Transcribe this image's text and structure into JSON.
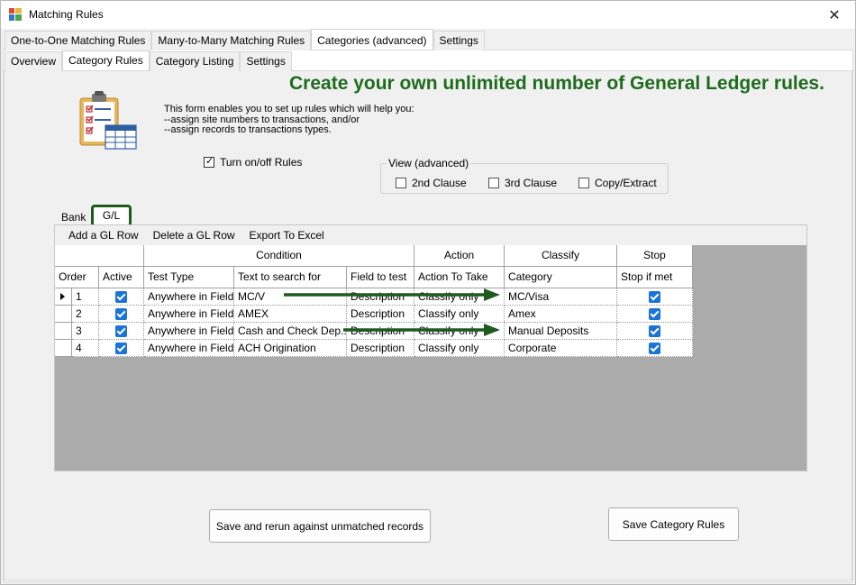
{
  "window": {
    "title": "Matching Rules",
    "close_glyph": "✕"
  },
  "tabs_main": [
    {
      "label": "One-to-One Matching Rules",
      "active": false
    },
    {
      "label": "Many-to-Many Matching Rules",
      "active": false
    },
    {
      "label": "Categories (advanced)",
      "active": true
    },
    {
      "label": "Settings",
      "active": false
    }
  ],
  "tabs_sub": [
    {
      "label": "Overview",
      "active": false
    },
    {
      "label": "Category Rules",
      "active": true
    },
    {
      "label": "Category Listing",
      "active": false
    },
    {
      "label": "Settings",
      "active": false
    }
  ],
  "headline": "Create your own unlimited number of General Ledger rules.",
  "intro": {
    "line1": "This form enables you to set up rules which will help you:",
    "line2": "--assign site numbers to transactions, and/or",
    "line3": "--assign records to transactions types."
  },
  "turn_rules": {
    "label": "Turn on/off Rules",
    "checked": true
  },
  "view_advanced": {
    "legend": "View (advanced)",
    "options": [
      {
        "label": "2nd Clause",
        "checked": false
      },
      {
        "label": "3rd Clause",
        "checked": false
      },
      {
        "label": "Copy/Extract",
        "checked": false
      }
    ]
  },
  "grid_tabs": {
    "bank": "Bank",
    "gl": "G/L"
  },
  "toolbar": {
    "add": "Add a GL Row",
    "delete": "Delete a GL Row",
    "export": "Export To Excel"
  },
  "grid": {
    "groups": [
      "Condition",
      "Action",
      "Classify",
      "Stop"
    ],
    "columns": [
      "Order",
      "Active",
      "Test Type",
      "Text to search for",
      "Field to test",
      "Action To Take",
      "Category",
      "Stop if met"
    ],
    "rows": [
      {
        "order": "1",
        "active": true,
        "test_type": "Anywhere in Field",
        "text": "MC/V",
        "field": "Description",
        "action": "Classify only",
        "category": "MC/Visa",
        "stop": true,
        "current": true
      },
      {
        "order": "2",
        "active": true,
        "test_type": "Anywhere in Field",
        "text": "AMEX",
        "field": "Description",
        "action": "Classify only",
        "category": "Amex",
        "stop": true,
        "current": false
      },
      {
        "order": "3",
        "active": true,
        "test_type": "Anywhere in Field",
        "text": "Cash and Check Dep...",
        "field": "Description",
        "action": "Classify only",
        "category": "Manual Deposits",
        "stop": true,
        "current": false
      },
      {
        "order": "4",
        "active": true,
        "test_type": "Anywhere in Field",
        "text": "ACH Origination",
        "field": "Description",
        "action": "Classify only",
        "category": "Corporate",
        "stop": true,
        "current": false
      }
    ]
  },
  "buttons": {
    "rerun": "Save and rerun against unmatched records",
    "save": "Save Category Rules"
  },
  "colors": {
    "headline": "#1e6b1e",
    "arrow": "#1e5a1e",
    "checkbox": "#1a73d9"
  }
}
